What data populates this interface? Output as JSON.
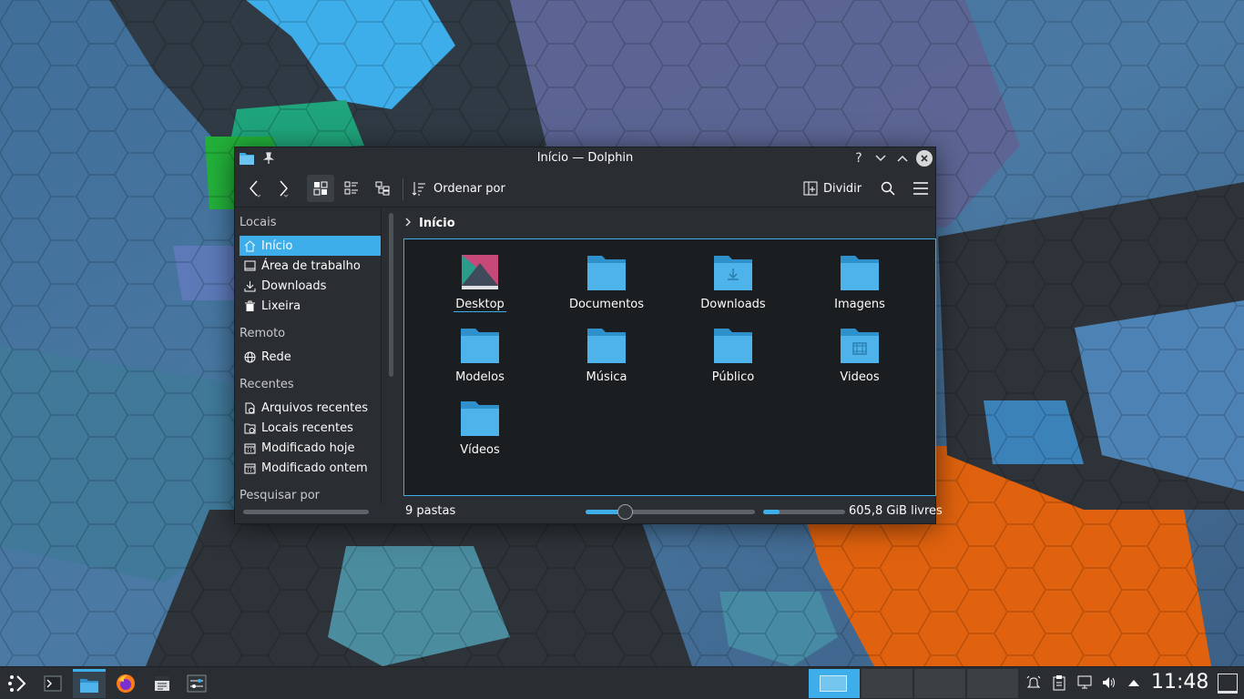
{
  "window": {
    "title": "Início — Dolphin",
    "help_glyph": "?"
  },
  "toolbar": {
    "sort_label": "Ordenar por",
    "split_label": "Dividir"
  },
  "sidebar": {
    "sections": {
      "locais": "Locais",
      "remoto": "Remoto",
      "recentes": "Recentes",
      "pesquisar": "Pesquisar por"
    },
    "locais": [
      {
        "label": "Início",
        "icon": "home-icon",
        "selected": true
      },
      {
        "label": "Área de trabalho",
        "icon": "desktop-icon"
      },
      {
        "label": "Downloads",
        "icon": "download-icon"
      },
      {
        "label": "Lixeira",
        "icon": "trash-icon"
      }
    ],
    "remoto": [
      {
        "label": "Rede",
        "icon": "network-icon"
      }
    ],
    "recentes": [
      {
        "label": "Arquivos recentes",
        "icon": "recent-files-icon"
      },
      {
        "label": "Locais recentes",
        "icon": "recent-places-icon"
      },
      {
        "label": "Modificado hoje",
        "icon": "calendar-icon"
      },
      {
        "label": "Modificado ontem",
        "icon": "calendar-icon"
      }
    ]
  },
  "breadcrumb": {
    "current": "Início"
  },
  "files": [
    {
      "name": "Desktop",
      "icon": "desktop-folder-icon"
    },
    {
      "name": "Documentos",
      "icon": "folder-icon"
    },
    {
      "name": "Downloads",
      "icon": "folder-download-icon"
    },
    {
      "name": "Imagens",
      "icon": "folder-icon"
    },
    {
      "name": "Modelos",
      "icon": "folder-icon"
    },
    {
      "name": "Música",
      "icon": "folder-icon"
    },
    {
      "name": "Público",
      "icon": "folder-icon"
    },
    {
      "name": "Videos",
      "icon": "folder-video-icon"
    },
    {
      "name": "Vídeos",
      "icon": "folder-icon"
    }
  ],
  "status": {
    "folder_count": "9 pastas",
    "zoom_fraction": 0.21,
    "space_used_fraction": 0.2,
    "free_space": "605,8 GiB livres"
  },
  "panel": {
    "clock": "11:48",
    "desktops": 4,
    "current_desktop": 1
  },
  "colors": {
    "accent": "#3daee9",
    "window_bg": "#2a2e32",
    "view_bg": "#1b1e20",
    "folder": "#4db3ea"
  }
}
